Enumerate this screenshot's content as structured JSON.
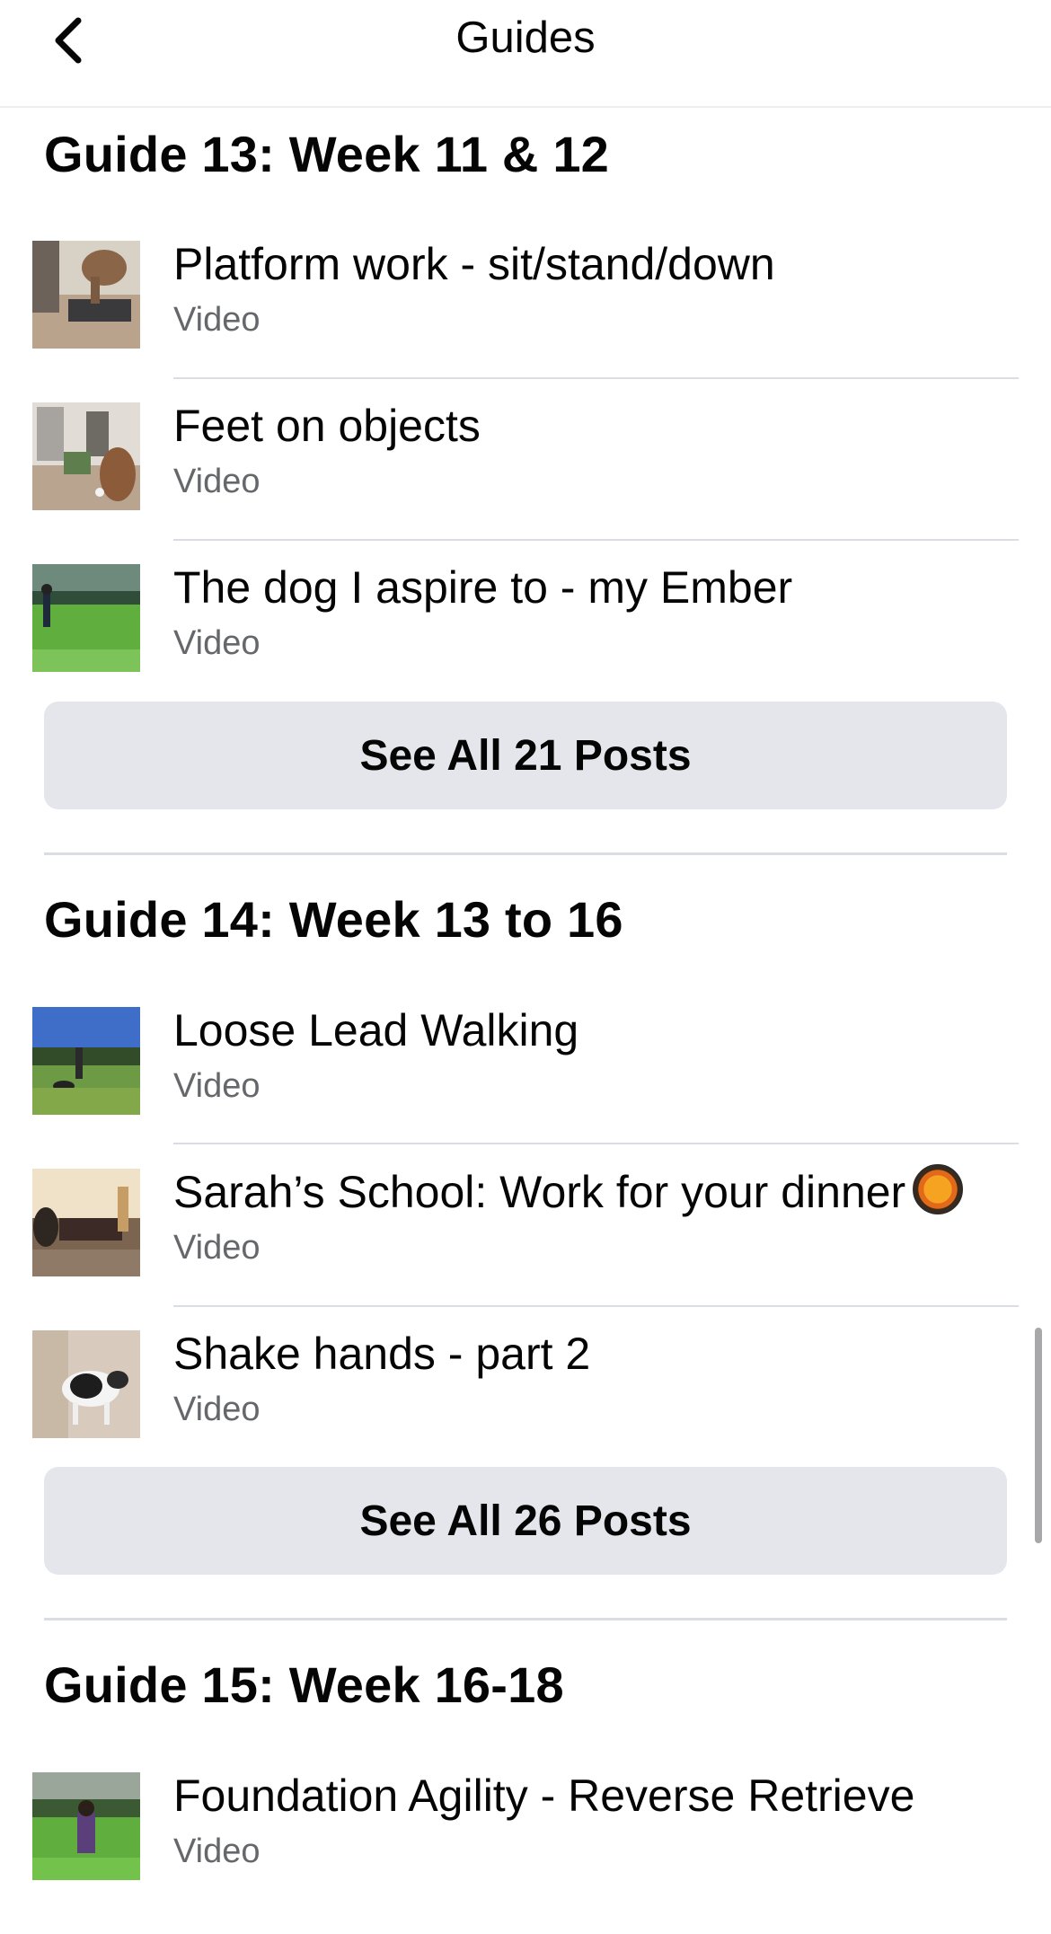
{
  "nav": {
    "title": "Guides"
  },
  "guides": [
    {
      "title": "Guide 13: Week 11 & 12",
      "items": [
        {
          "title": "Platform work - sit/stand/down",
          "type": "Video"
        },
        {
          "title": "Feet on objects",
          "type": "Video"
        },
        {
          "title": "The dog I aspire to - my Ember",
          "type": "Video"
        }
      ],
      "see_all": "See All 21 Posts"
    },
    {
      "title": "Guide 14: Week 13 to 16",
      "items": [
        {
          "title": "Loose Lead Walking",
          "type": "Video"
        },
        {
          "title": "Sarah’s School: Work for your dinner",
          "type": "Video"
        },
        {
          "title": "Shake hands - part 2",
          "type": "Video"
        }
      ],
      "see_all": "See All 26 Posts"
    },
    {
      "title": "Guide 15: Week 16-18",
      "items": [
        {
          "title": "Foundation Agility - Reverse Retrieve",
          "type": "Video"
        }
      ]
    }
  ]
}
